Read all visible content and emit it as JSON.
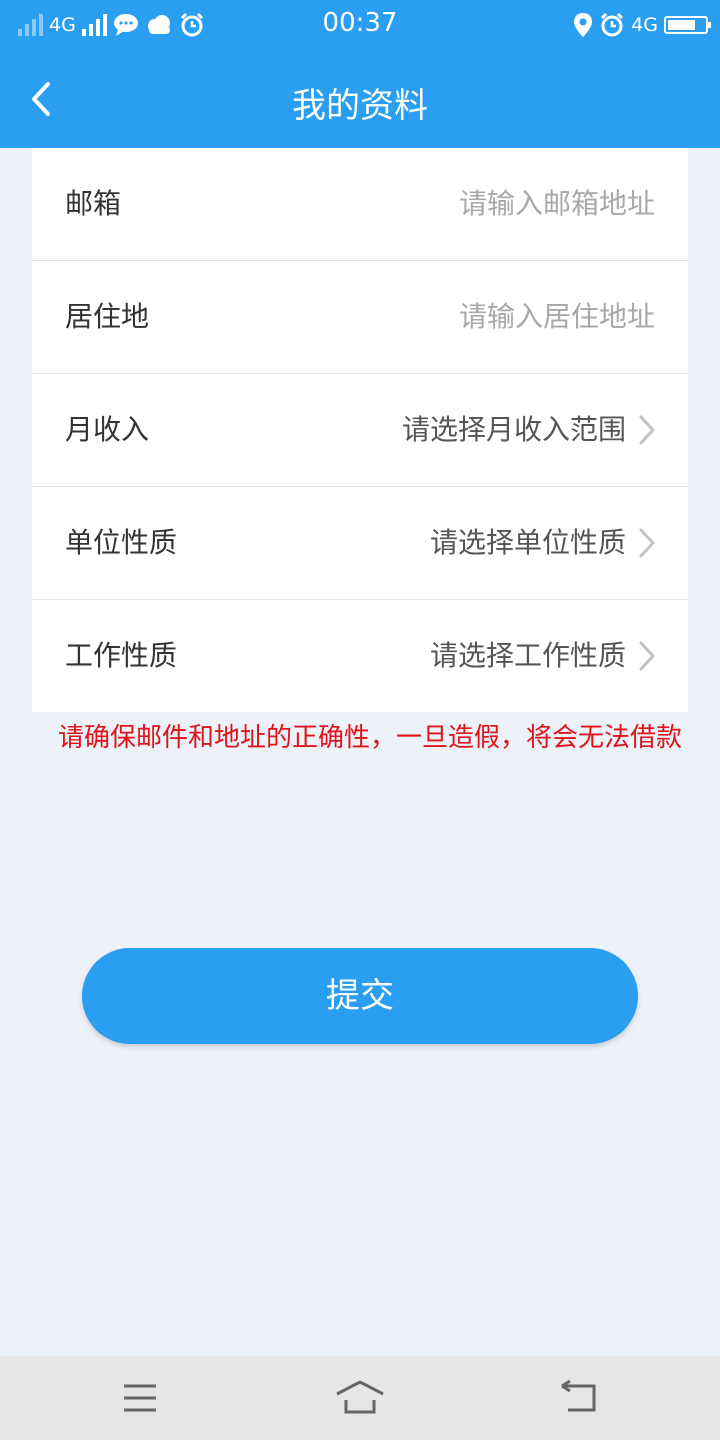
{
  "status_bar": {
    "network_left": "4G",
    "time": "00:37",
    "network_right": "4G",
    "battery_level": 0.75
  },
  "header": {
    "title": "我的资料"
  },
  "form": {
    "rows": [
      {
        "label": "邮箱",
        "placeholder": "请输入邮箱地址"
      },
      {
        "label": "居住地",
        "placeholder": "请输入居住地址"
      },
      {
        "label": "月收入",
        "value": "请选择月收入范围"
      },
      {
        "label": "单位性质",
        "value": "请选择单位性质"
      },
      {
        "label": "工作性质",
        "value": "请选择工作性质"
      }
    ]
  },
  "warning_text": "请确保邮件和地址的正确性，一旦造假，将会无法借款",
  "submit_label": "提交",
  "colors": {
    "primary": "#2a9ef0",
    "warning": "#e0131b",
    "background": "#edf2f9"
  }
}
